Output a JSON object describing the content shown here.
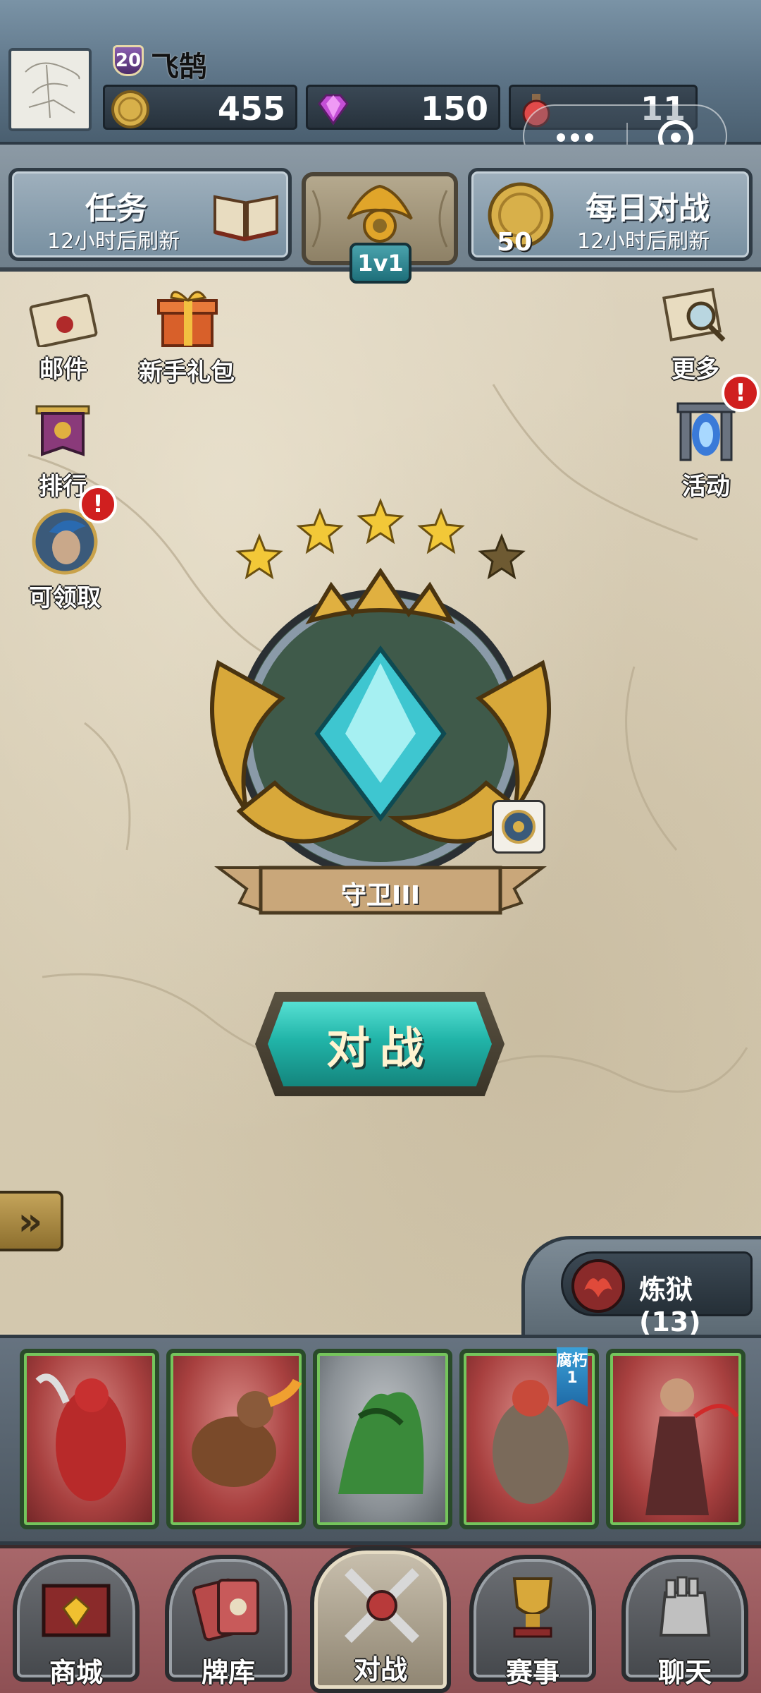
{
  "player": {
    "name": "飞鹄",
    "level": "20"
  },
  "resources": {
    "gold": "455",
    "gems": "150",
    "potion": "11"
  },
  "tabs": {
    "quest_title": "任务",
    "quest_sub": "12小时后刷新",
    "mode_label": "1v1",
    "daily_title": "每日对战",
    "daily_sub": "12小时后刷新",
    "daily_coin": "50"
  },
  "side_menu": {
    "mail": "邮件",
    "newbie_gift": "新手礼包",
    "ranking": "排行",
    "claimable": "可领取",
    "more": "更多",
    "events": "活动",
    "alert": "!"
  },
  "rank": {
    "stars_filled": 4,
    "stars_total": 5,
    "name": "守卫III"
  },
  "battle_button": "对战",
  "expand_arrows": "»",
  "faction": {
    "label": "炼狱(13)"
  },
  "deck": {
    "card_badge": "腐朽 1"
  },
  "bottom_nav": {
    "shop": "商城",
    "cards": "牌库",
    "battle": "对战",
    "events": "赛事",
    "chat": "聊天"
  },
  "colors": {
    "accent_teal": "#21b4a8",
    "alert_red": "#d01f1f",
    "gold": "#d8b04a",
    "card_border_green": "#75c55c"
  }
}
